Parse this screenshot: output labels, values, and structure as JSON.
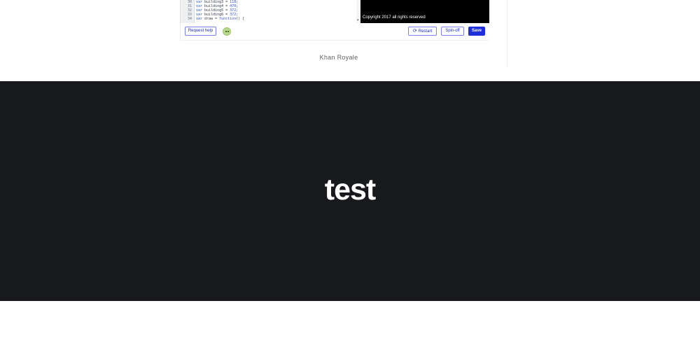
{
  "editor": {
    "line_numbers": [
      "30",
      "31",
      "32",
      "33",
      "34"
    ],
    "code_lines": [
      {
        "kw": "var",
        "text": " building3 = ",
        "num": "118",
        "end": ";"
      },
      {
        "kw": "var",
        "text": " building4 = ",
        "num": "470",
        "end": ";"
      },
      {
        "kw": "var",
        "text": " building5 = ",
        "num": "372",
        "end": ";"
      },
      {
        "kw": "var",
        "text": " building6 = ",
        "num": "372",
        "end": ";"
      },
      {
        "kw": "var",
        "text": " draw = ",
        "num": "function",
        "end": "() {"
      }
    ]
  },
  "canvas": {
    "copyright": "Copyright 2017 all rights reserved"
  },
  "toolbar": {
    "request_help_label": "Request help",
    "restart_label": "Restart",
    "spinoff_label": "Spin-off",
    "save_label": "Save"
  },
  "author": {
    "name": "Khan Royale"
  },
  "band": {
    "title": "test",
    "background": "#18191d"
  },
  "colors": {
    "accent": "#1f2fdc",
    "canvas_bg": "#000000"
  },
  "icons": {
    "restart": "refresh-icon",
    "avatar": "green-avatar-icon"
  }
}
